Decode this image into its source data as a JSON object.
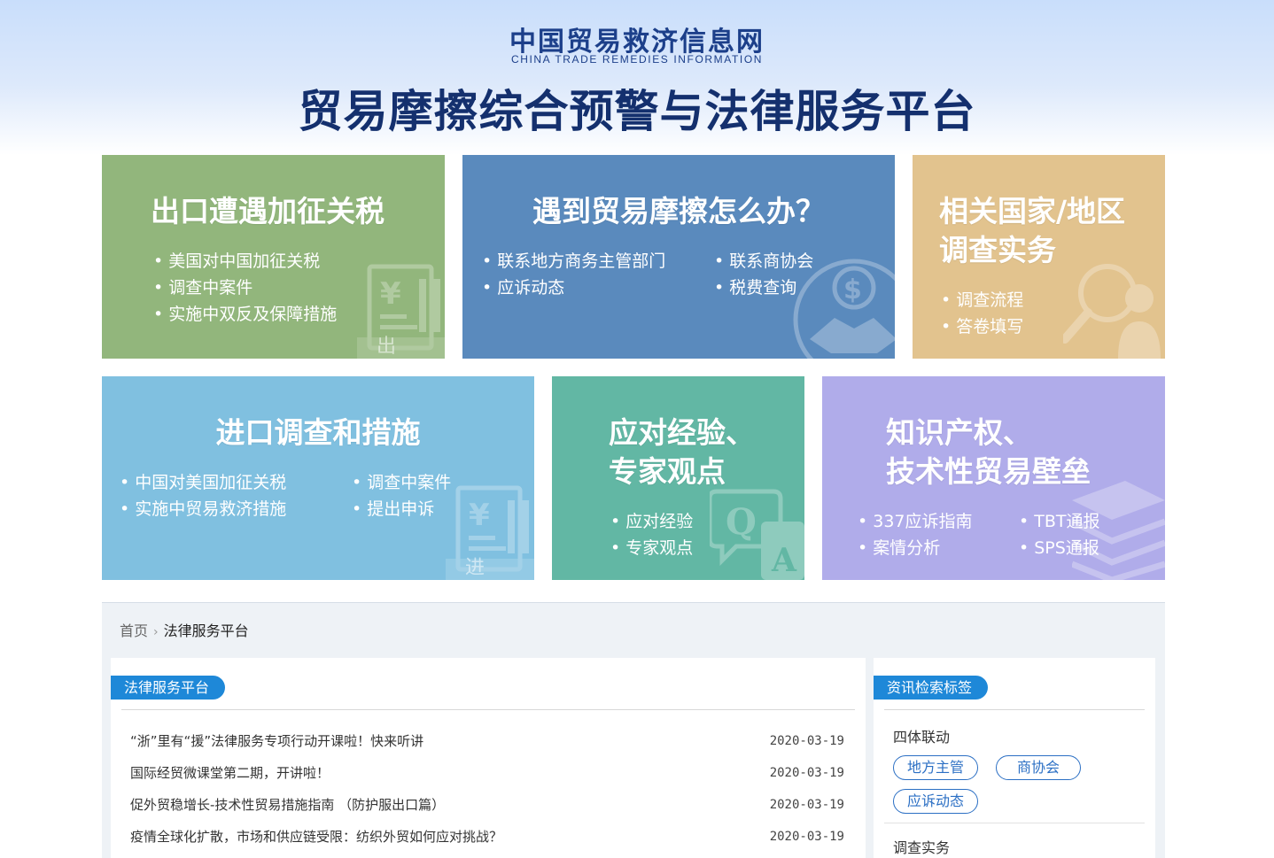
{
  "header": {
    "site_name_cn": "中国贸易救济信息网",
    "site_name_en": "CHINA TRADE REMEDIES INFORMATION",
    "platform_title": "贸易摩擦综合预警与法律服务平台"
  },
  "tiles": {
    "export": {
      "title": "出口遭遇加征关税",
      "items": [
        "美国对中国加征关税",
        "调查中案件",
        "实施中双反及保障措施"
      ],
      "badge": "出 口",
      "color": "#92b67c"
    },
    "friction": {
      "title": "遇到贸易摩擦怎么办？",
      "items_left": [
        "联系地方商务主管部门",
        "应诉动态"
      ],
      "items_right": [
        "联系商协会",
        "税费查询"
      ],
      "color": "#5a8abd"
    },
    "countries": {
      "title_line1": "相关国家/地区",
      "title_line2": "调查实务",
      "items": [
        "调查流程",
        "答卷填写"
      ],
      "color": "#e2c38e"
    },
    "import": {
      "title": "进口调查和措施",
      "items_left": [
        "中国对美国加征关税",
        "实施中贸易救济措施"
      ],
      "items_right": [
        "调查中案件",
        "提出申诉"
      ],
      "badge": "进 口",
      "color": "#80c0e0"
    },
    "expert": {
      "title_line1": "应对经验、",
      "title_line2": "专家观点",
      "items": [
        "应对经验",
        "专家观点"
      ],
      "color": "#62b7a4"
    },
    "ip": {
      "title_line1": "知识产权、",
      "title_line2": "技术性贸易壁垒",
      "items_left": [
        "337应诉指南",
        "案情分析"
      ],
      "items_right": [
        "TBT通报",
        "SPS通报"
      ],
      "color": "#b0acea"
    }
  },
  "breadcrumb": {
    "home": "首页",
    "current": "法律服务平台"
  },
  "main_panel": {
    "tab_label": "法律服务平台",
    "news": [
      {
        "title": "“浙”里有“援”法律服务专项行动开课啦！快来听讲",
        "date": "2020-03-19"
      },
      {
        "title": "国际经贸微课堂第二期，开讲啦！",
        "date": "2020-03-19"
      },
      {
        "title": "促外贸稳增长-技术性贸易措施指南 （防护服出口篇）",
        "date": "2020-03-19"
      },
      {
        "title": "疫情全球化扩散，市场和供应链受限：纺织外贸如何应对挑战？",
        "date": "2020-03-19"
      }
    ]
  },
  "side_panel": {
    "tab_label": "资讯检索标签",
    "groups": [
      {
        "label": "四体联动",
        "tags": [
          "地方主管",
          "商协会",
          "应诉动态"
        ]
      },
      {
        "label": "调查实务",
        "tags": []
      }
    ]
  },
  "colors": {
    "tab_blue": "#1e88d8",
    "tag_blue": "#2b6fc4",
    "title_navy": "#14306e"
  }
}
